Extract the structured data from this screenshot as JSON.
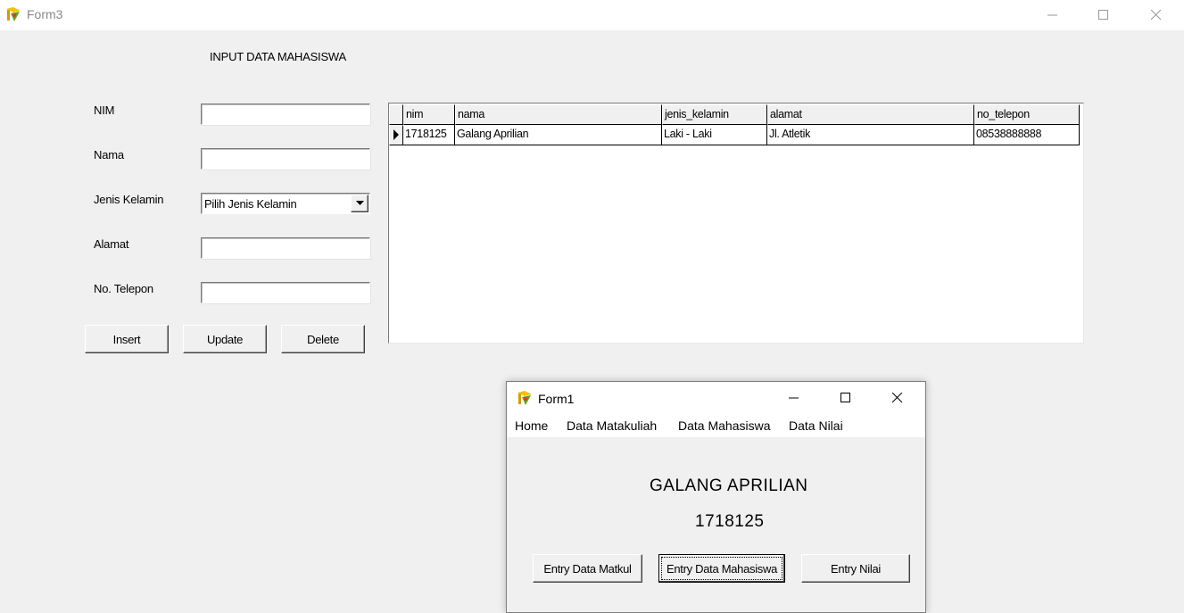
{
  "form3": {
    "title": "Form3",
    "heading": "INPUT DATA MAHASISWA",
    "fields": {
      "nim_label": "NIM",
      "nama_label": "Nama",
      "jenis_kelamin_label": "Jenis Kelamin",
      "alamat_label": "Alamat",
      "telepon_label": "No. Telepon",
      "nim_value": "",
      "nama_value": "",
      "jenis_kelamin_selected": "Pilih Jenis Kelamin",
      "alamat_value": "",
      "telepon_value": ""
    },
    "buttons": {
      "insert": "Insert",
      "update": "Update",
      "delete": "Delete"
    },
    "grid": {
      "columns": [
        "nim",
        "nama",
        "jenis_kelamin",
        "alamat",
        "no_telepon"
      ],
      "rows": [
        [
          "1718125",
          "Galang Aprilian",
          "Laki - Laki",
          "Jl. Atletik",
          "08538888888"
        ]
      ],
      "current_row_indicator": "▶"
    }
  },
  "form1": {
    "title": "Form1",
    "menu": [
      "Home",
      "Data Matakuliah",
      "Data Mahasiswa",
      "Data Nilai"
    ],
    "name_text": "GALANG APRILIAN",
    "nim_text": "1718125",
    "buttons": {
      "entry_matkul": "Entry Data Matkul",
      "entry_mahasiswa": "Entry Data Mahasiswa",
      "entry_nilai": "Entry Nilai"
    }
  },
  "icons": [
    "app-icon",
    "minimize-icon",
    "maximize-icon",
    "close-icon",
    "dropdown-arrow-icon",
    "row-indicator-icon"
  ]
}
